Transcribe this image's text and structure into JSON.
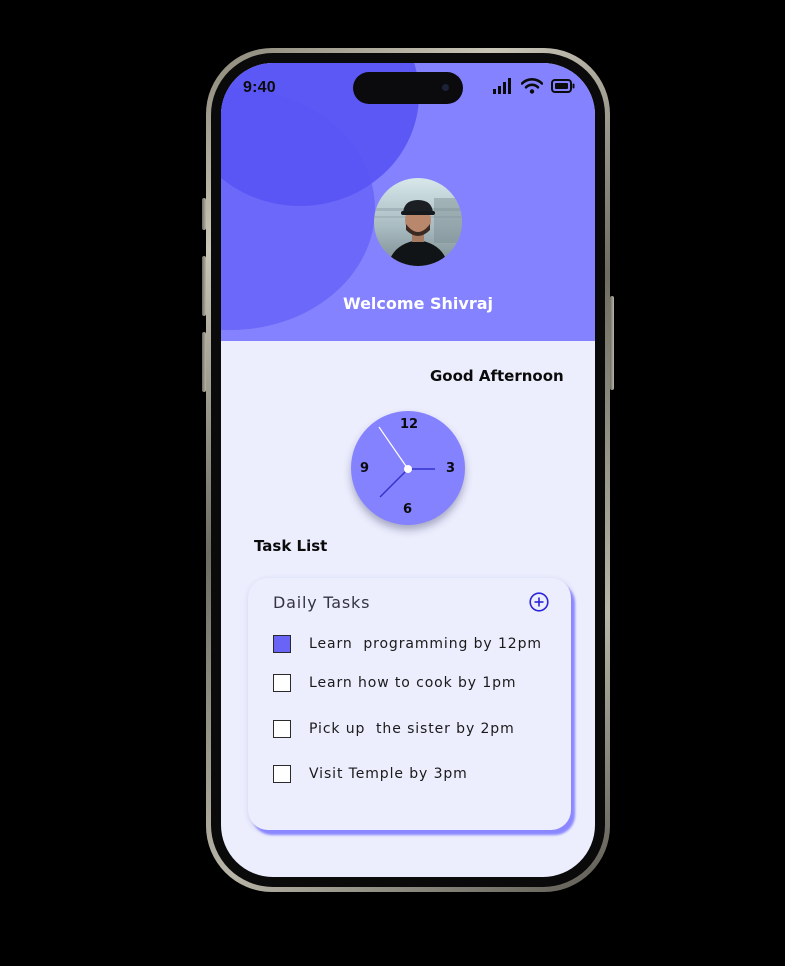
{
  "status_bar": {
    "time": "9:40"
  },
  "header": {
    "welcome_text": "Welcome Shivraj"
  },
  "greeting": "Good Afternoon",
  "clock": {
    "numbers": [
      "12",
      "3",
      "6",
      "9"
    ]
  },
  "tasks_section": {
    "title": "Task List",
    "card": {
      "title": "Daily Tasks",
      "items": [
        {
          "label": "Learn  programming by 12pm",
          "checked": true
        },
        {
          "label": "Learn how to cook by 1pm",
          "checked": false
        },
        {
          "label": "Pick up  the sister by 2pm",
          "checked": false
        },
        {
          "label": "Visit Temple by 3pm",
          "checked": false
        }
      ]
    }
  },
  "colors": {
    "header_background": "#8582ff",
    "page_background": "#eceefe",
    "accent": "#6964f5",
    "clock_face": "#8582ff",
    "add_icon": "#2b24d9"
  },
  "icons": [
    "signal-icon",
    "wifi-icon",
    "battery-icon",
    "add-circle-icon"
  ]
}
